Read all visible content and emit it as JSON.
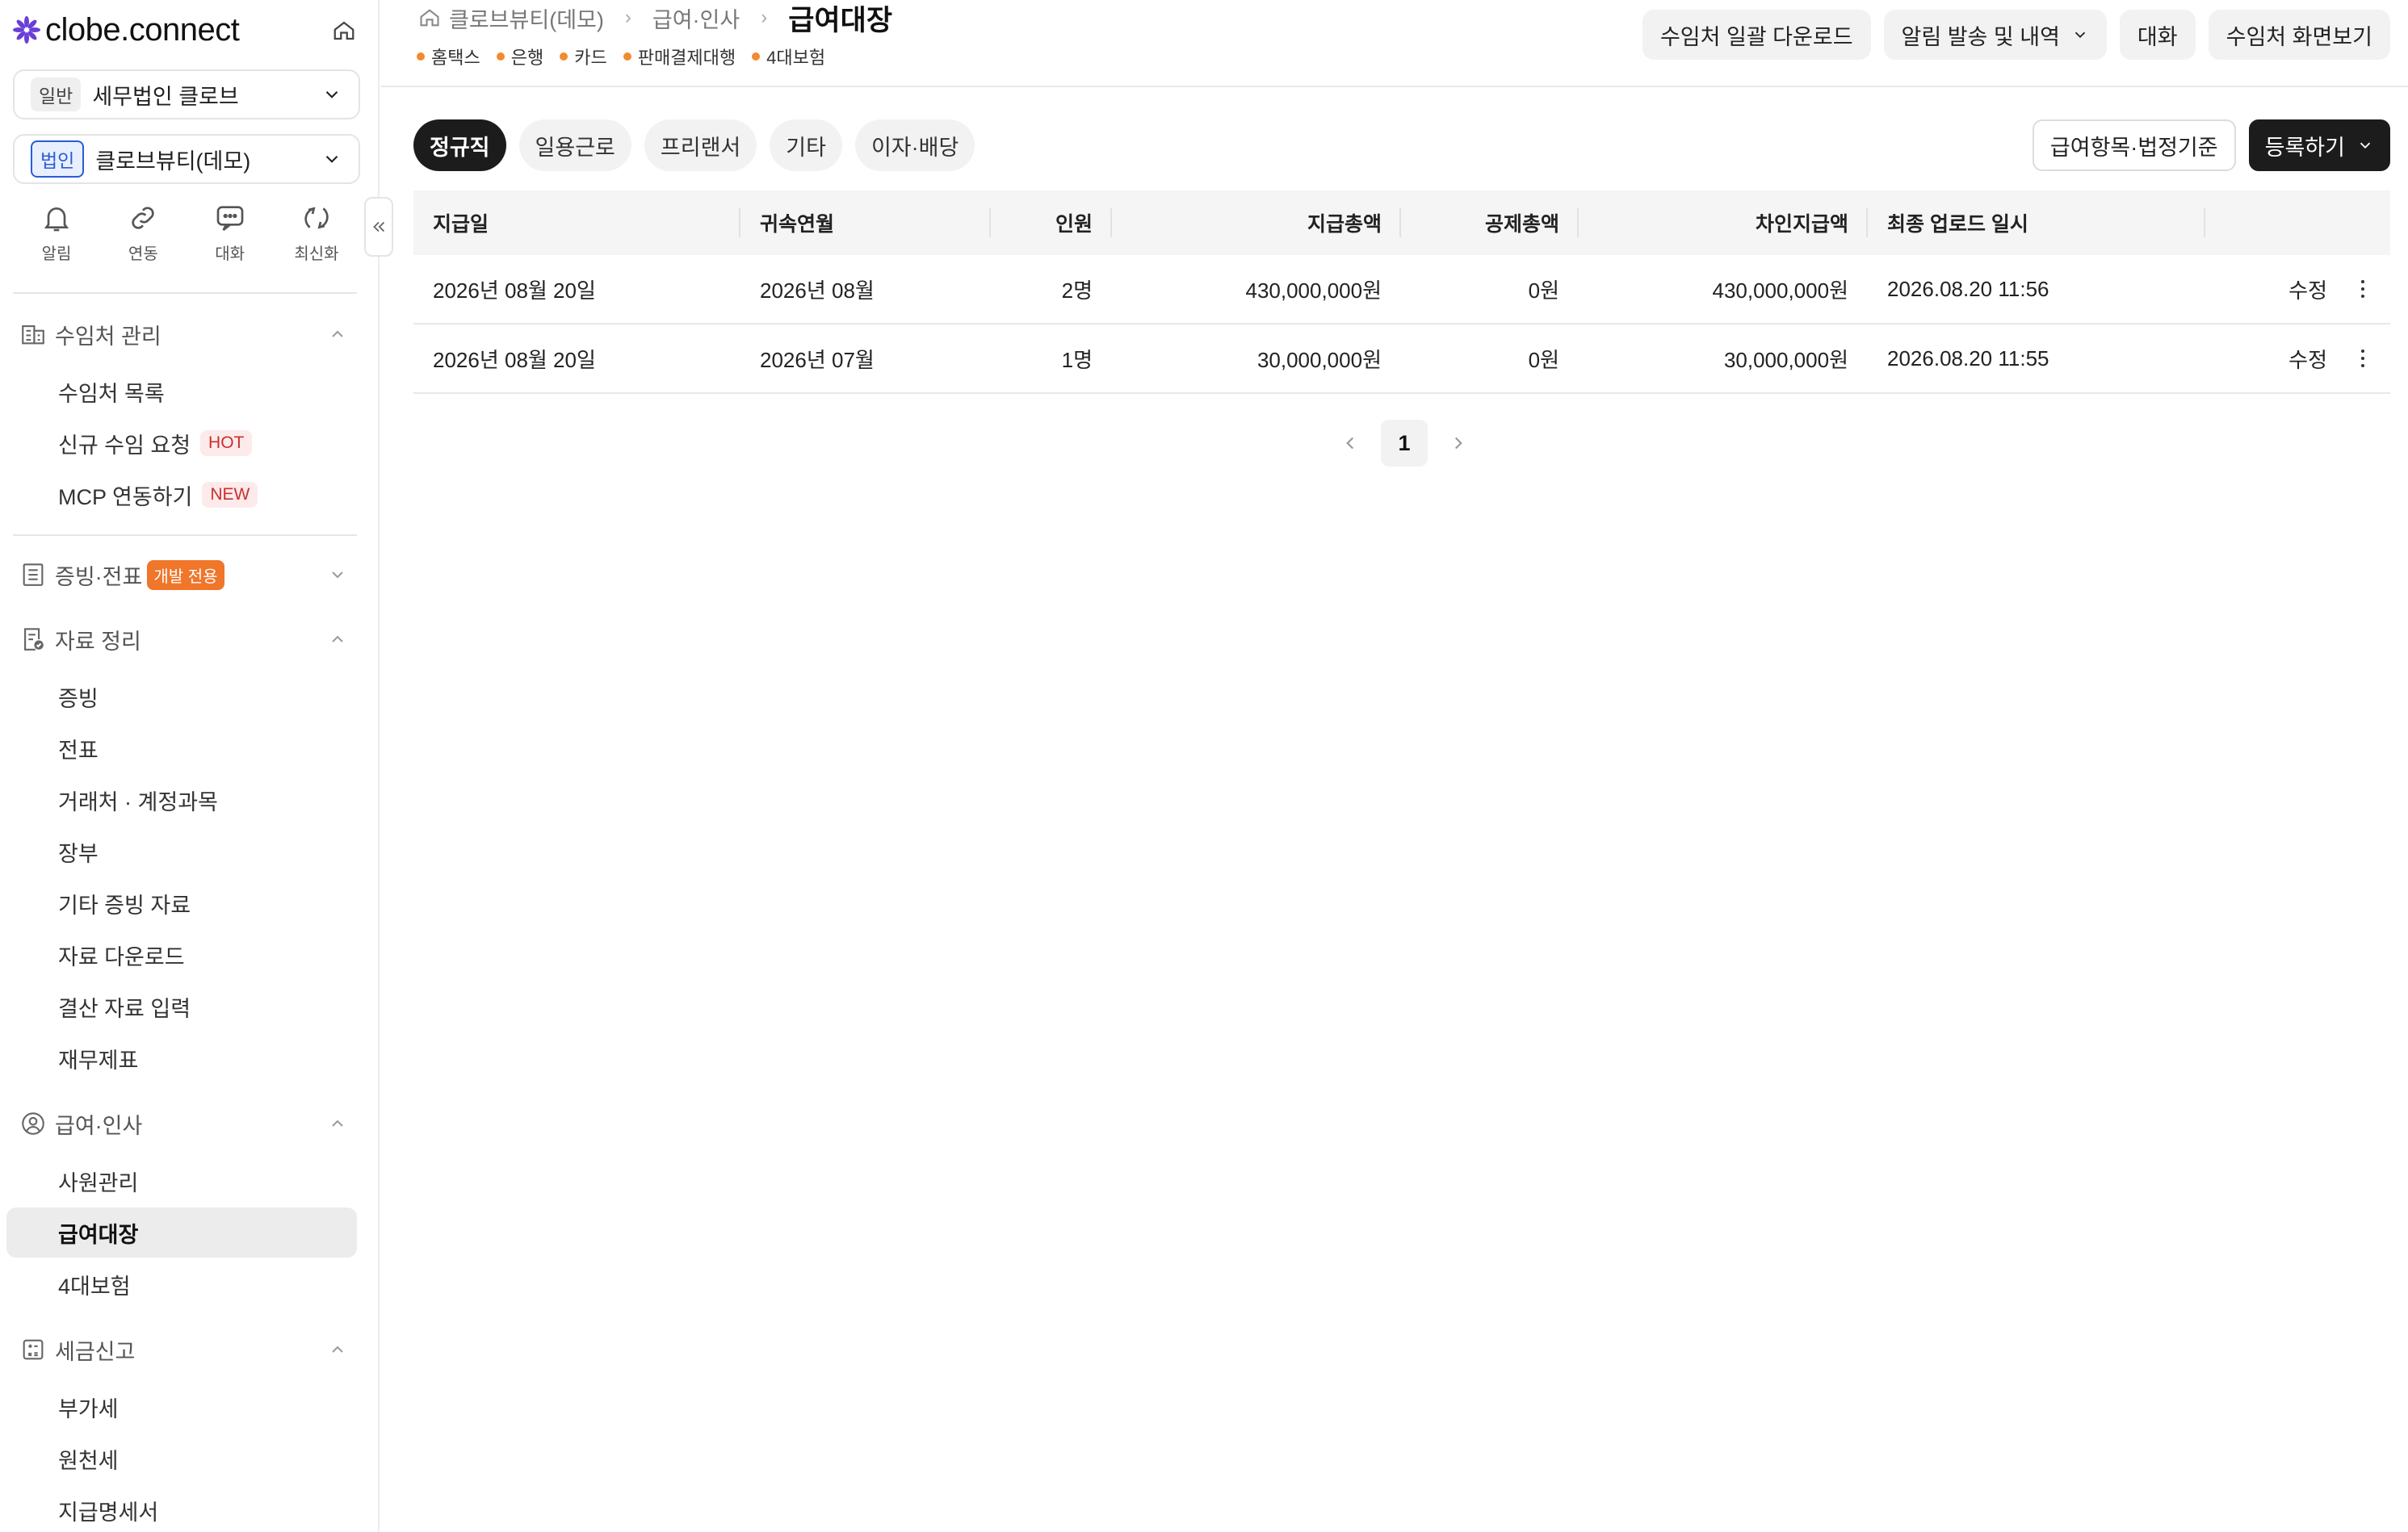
{
  "app": {
    "logo_text": "clobe.connect"
  },
  "sidebar": {
    "org1": {
      "tag": "일반",
      "name": "세무법인 클로브"
    },
    "org2": {
      "tag": "법인",
      "name": "클로브뷰티(데모)"
    },
    "quick": [
      {
        "label": "알림",
        "icon": "bell-icon"
      },
      {
        "label": "연동",
        "icon": "link-icon"
      },
      {
        "label": "대화",
        "icon": "chat-icon"
      },
      {
        "label": "최신화",
        "icon": "refresh-icon"
      }
    ],
    "sections": {
      "clients": {
        "label": "수임처 관리",
        "items": [
          "수임처 목록",
          "신규 수임 요청",
          "MCP 연동하기"
        ],
        "hot": "HOT",
        "new": "NEW"
      },
      "evidence": {
        "label": "증빙·전표",
        "badge": "개발 전용"
      },
      "data": {
        "label": "자료 정리",
        "items": [
          "증빙",
          "전표",
          "거래처 · 계정과목",
          "장부",
          "기타 증빙 자료",
          "자료 다운로드",
          "결산 자료 입력",
          "재무제표"
        ]
      },
      "payroll": {
        "label": "급여·인사",
        "items": [
          "사원관리",
          "급여대장",
          "4대보험"
        ]
      },
      "tax": {
        "label": "세금신고",
        "items": [
          "부가세",
          "원천세",
          "지급명세서"
        ]
      }
    }
  },
  "header": {
    "breadcrumb": [
      "클로브뷰티(데모)",
      "급여·인사"
    ],
    "title": "급여대장",
    "sources": [
      "홈택스",
      "은행",
      "카드",
      "판매결제대행",
      "4대보험"
    ],
    "actions": [
      "수임처 일괄 다운로드",
      "알림 발송 및 내역",
      "대화",
      "수임처 화면보기"
    ]
  },
  "tabs": [
    "정규직",
    "일용근로",
    "프리랜서",
    "기타",
    "이자·배당"
  ],
  "toolbar": {
    "standards_label": "급여항목·법정기준",
    "register_label": "등록하기"
  },
  "table": {
    "columns": [
      "지급일",
      "귀속연월",
      "인원",
      "지급총액",
      "공제총액",
      "차인지급액",
      "최종 업로드 일시"
    ],
    "rows": [
      {
        "pay_date": "2026년 08월 20일",
        "period": "2026년 08월",
        "people": "2명",
        "gross": "430,000,000원",
        "deduction": "0원",
        "net": "430,000,000원",
        "uploaded": "2026.08.20 11:56",
        "edit": "수정"
      },
      {
        "pay_date": "2026년 08월 20일",
        "period": "2026년 07월",
        "people": "1명",
        "gross": "30,000,000원",
        "deduction": "0원",
        "net": "30,000,000원",
        "uploaded": "2026.08.20 11:55",
        "edit": "수정"
      }
    ]
  },
  "pagination": {
    "current": "1"
  },
  "colors": {
    "accent_dark": "#1c1c1c",
    "source_dot": "#f28a2e",
    "hot_badge": "#c93030",
    "dev_badge": "#f0762a",
    "logo_purple": "#6a3fd8"
  }
}
